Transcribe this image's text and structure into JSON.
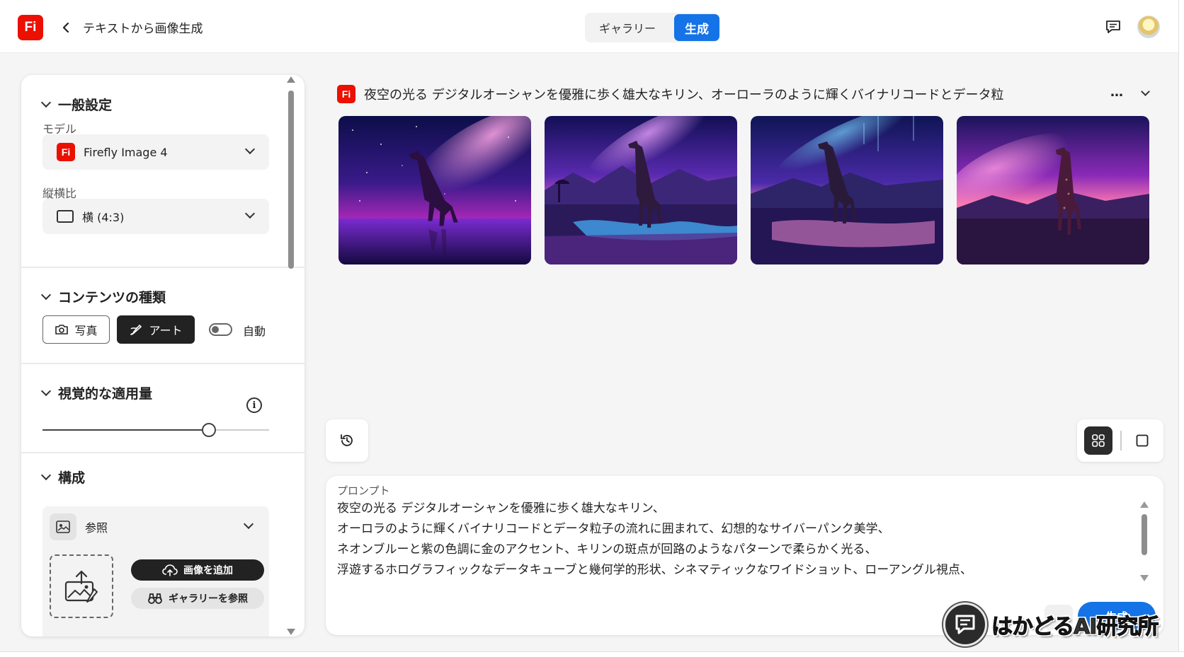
{
  "app": {
    "logo_text": "Fi",
    "page_title": "テキストから画像生成",
    "brand_color": "#eb1000",
    "accent_color": "#1473e6"
  },
  "header": {
    "tabs": {
      "gallery": "ギャラリー",
      "generate": "生成"
    },
    "active_tab": "生成",
    "icons": [
      "chevron-left-icon",
      "chat-icon",
      "avatar"
    ]
  },
  "sidebar": {
    "general": {
      "title": "一般設定",
      "model_label": "モデル",
      "model_value": "Firefly Image 4",
      "aspect_label": "縦横比",
      "aspect_value": "横 (4:3)"
    },
    "content_type": {
      "title": "コンテンツの種類",
      "photo": "写真",
      "art": "アート",
      "selected": "アート",
      "auto_label": "自動",
      "auto_on": false
    },
    "visual_intensity": {
      "title": "視覚的な適用量",
      "level": 0.735
    },
    "composition": {
      "title": "構成",
      "reference_label": "参照",
      "add_image": "画像を追加",
      "browse_gallery": "ギャラリーを参照"
    }
  },
  "main": {
    "prompt_header": "夜空の光る デジタルオーシャンを優雅に歩く雄大なキリン、オーローラのように輝くバイナリコードとデータ粒",
    "ellipsis": "…",
    "images": [
      {
        "alt": "giraffe-image-1"
      },
      {
        "alt": "giraffe-image-2"
      },
      {
        "alt": "giraffe-image-3"
      },
      {
        "alt": "giraffe-image-4"
      }
    ],
    "view_mode": "grid",
    "prompt": {
      "label": "プロンプト",
      "lines": [
        "夜空の光る デジタルオーシャンを優雅に歩く雄大なキリン、",
        "オーロラのように輝くバイナリコードとデータ粒子の流れに囲まれて、幻想的なサイバーパンク美学、",
        "ネオンブルーと紫の色調に金のアクセント、キリンの斑点が回路のようなパターンで柔らかく光る、",
        "浮遊するホログラフィックなデータキューブと幾何学的形状、シネマティックなワイドショット、ローアングル視点、"
      ],
      "generate_label": "生成"
    }
  },
  "watermark": {
    "text": "はかどるAI研究所"
  }
}
